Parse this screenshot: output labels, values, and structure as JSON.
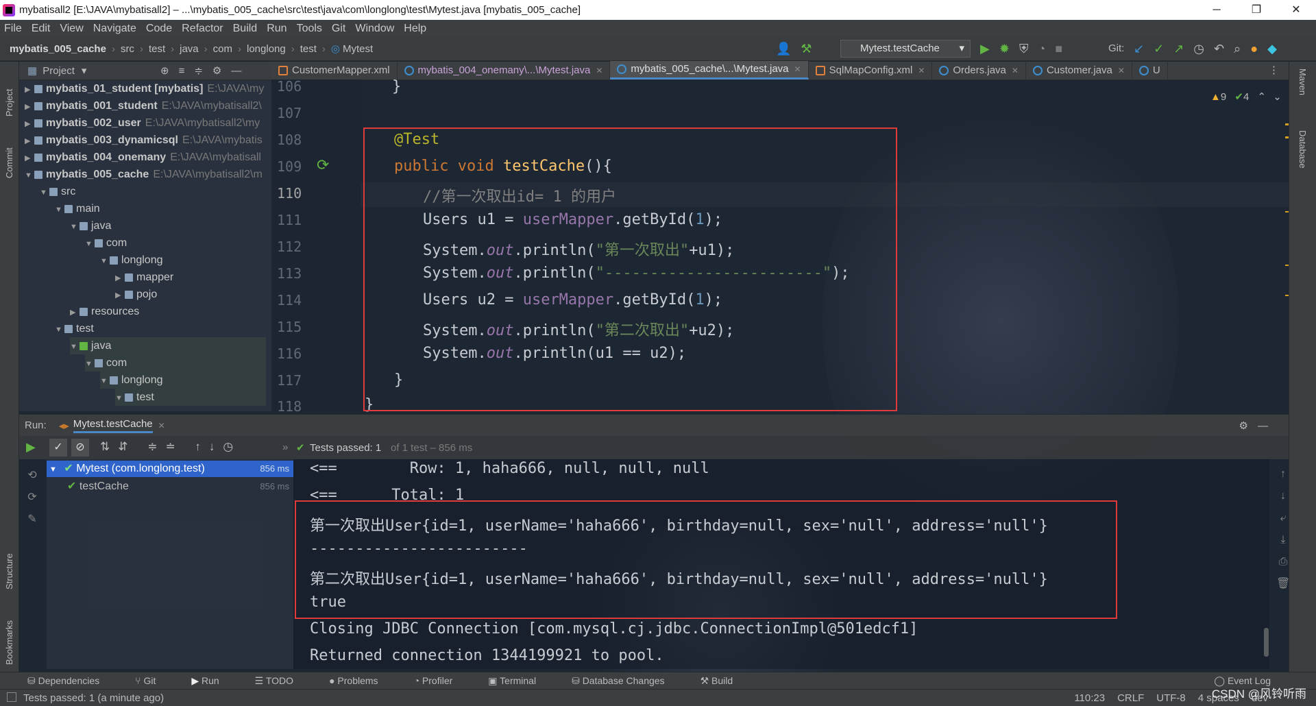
{
  "window": {
    "title": "mybatisall2 [E:\\JAVA\\mybatisall2] – ...\\mybatis_005_cache\\src\\test\\java\\com\\longlong\\test\\Mytest.java [mybatis_005_cache]"
  },
  "menu": [
    "File",
    "Edit",
    "View",
    "Navigate",
    "Code",
    "Refactor",
    "Build",
    "Run",
    "Tools",
    "Git",
    "Window",
    "Help"
  ],
  "breadcrumb": [
    "mybatis_005_cache",
    "src",
    "test",
    "java",
    "com",
    "longlong",
    "test",
    "Mytest"
  ],
  "run_config": "Mytest.testCache",
  "git_label": "Git:",
  "project_panel": {
    "title": "Project",
    "rows": [
      {
        "label": "mybatis_01_student [mybatis]",
        "path": "E:\\JAVA\\my"
      },
      {
        "label": "mybatis_001_student",
        "path": "E:\\JAVA\\mybatisall2\\"
      },
      {
        "label": "mybatis_002_user",
        "path": "E:\\JAVA\\mybatisall2\\my"
      },
      {
        "label": "mybatis_003_dynamicsql",
        "path": "E:\\JAVA\\mybatis"
      },
      {
        "label": "mybatis_004_onemany",
        "path": "E:\\JAVA\\mybatisall"
      },
      {
        "label": "mybatis_005_cache",
        "path": "E:\\JAVA\\mybatisall2\\m"
      },
      {
        "label": "src",
        "path": ""
      },
      {
        "label": "main",
        "path": ""
      },
      {
        "label": "java",
        "path": ""
      },
      {
        "label": "com",
        "path": ""
      },
      {
        "label": "longlong",
        "path": ""
      },
      {
        "label": "mapper",
        "path": ""
      },
      {
        "label": "pojo",
        "path": ""
      },
      {
        "label": "resources",
        "path": ""
      },
      {
        "label": "test",
        "path": ""
      },
      {
        "label": "java",
        "path": ""
      },
      {
        "label": "com",
        "path": ""
      },
      {
        "label": "longlong",
        "path": ""
      },
      {
        "label": "test",
        "path": ""
      }
    ]
  },
  "tabs": [
    {
      "label": "CustomerMapper.xml"
    },
    {
      "label": "mybatis_004_onemany\\...\\Mytest.java"
    },
    {
      "label": "mybatis_005_cache\\...\\Mytest.java"
    },
    {
      "label": "SqlMapConfig.xml"
    },
    {
      "label": "Orders.java"
    },
    {
      "label": "Customer.java"
    },
    {
      "label": "U"
    }
  ],
  "inspections": {
    "warnings": "9",
    "ok": "4"
  },
  "editor": {
    "line_numbers": [
      "106",
      "107",
      "108",
      "109",
      "110",
      "111",
      "112",
      "113",
      "114",
      "115",
      "116",
      "117",
      "118"
    ],
    "code": {
      "l106": "}",
      "l108": "@Test",
      "l109_kw": "public void ",
      "l109_fn": "testCache",
      "l109_rest": "(){",
      "l110": "//第一次取出id= 1 的用户",
      "l111_a": "Users u1 = ",
      "l111_b": "userMapper",
      "l111_c": ".getById(",
      "l111_d": "1",
      "l111_e": ");",
      "l112_a": "System.",
      "l112_b": "out",
      "l112_c": ".println(",
      "l112_d": "\"第一次取出\"",
      "l112_e": "+u1);",
      "l113_a": "System.",
      "l113_b": "out",
      "l113_c": ".println(",
      "l113_d": "\"------------------------\"",
      "l113_e": ");",
      "l114_a": "Users u2 = ",
      "l114_b": "userMapper",
      "l114_c": ".getById(",
      "l114_d": "1",
      "l114_e": ");",
      "l115_a": "System.",
      "l115_b": "out",
      "l115_c": ".println(",
      "l115_d": "\"第二次取出\"",
      "l115_e": "+u2);",
      "l116_a": "System.",
      "l116_b": "out",
      "l116_c": ".println(u1 == u2);",
      "l117": "}",
      "l118": "}"
    }
  },
  "run_panel": {
    "label": "Run:",
    "tab": "Mytest.testCache",
    "status_a": "Tests passed: 1",
    "status_b": "of 1 test – 856 ms",
    "tree": [
      {
        "label": "Mytest (com.longlong.test)",
        "time": "856 ms"
      },
      {
        "label": "testCache",
        "time": "856 ms"
      }
    ],
    "console": [
      "<==        Row: 1, haha666, null, null, null",
      "<==      Total: 1",
      "第一次取出User{id=1, userName='haha666', birthday=null, sex='null', address='null'}",
      "------------------------",
      "第二次取出User{id=1, userName='haha666', birthday=null, sex='null', address='null'}",
      "true",
      "Closing JDBC Connection [com.mysql.cj.jdbc.ConnectionImpl@501edcf1]",
      "Returned connection 1344199921 to pool."
    ]
  },
  "bottom_tabs": [
    "Dependencies",
    "Git",
    "Run",
    "TODO",
    "Problems",
    "Profiler",
    "Terminal",
    "Database Changes",
    "Build"
  ],
  "event_log": "Event Log",
  "statusbar": {
    "left": "Tests passed: 1 (a minute ago)",
    "position": "110:23",
    "line_sep": "CRLF",
    "encoding": "UTF-8",
    "indent": "4 spaces",
    "branch": "dev",
    "watermark": "CSDN @风铃听雨"
  },
  "side_labels": {
    "project": "Project",
    "commit": "Commit",
    "structure": "Structure",
    "bookmarks": "Bookmarks",
    "maven": "Maven",
    "database": "Database"
  },
  "colors": {
    "keyword": "#cc7832",
    "function": "#ffc66d",
    "annotation": "#bbb529",
    "field": "#9876aa",
    "number": "#6897bb",
    "string": "#6a8759",
    "highlight": "#e03a3a",
    "pass": "#62b543"
  }
}
